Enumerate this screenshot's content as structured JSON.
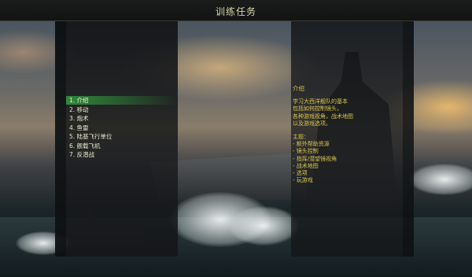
{
  "window": {
    "title": "训练任务"
  },
  "menu": {
    "items": [
      {
        "label": "1. 介绍",
        "selected": true
      },
      {
        "label": "2. 移动",
        "selected": false
      },
      {
        "label": "3. 炮术",
        "selected": false
      },
      {
        "label": "4. 鱼雷",
        "selected": false
      },
      {
        "label": "5. 陆基飞行单位",
        "selected": false
      },
      {
        "label": "6. 舰载飞机",
        "selected": false
      },
      {
        "label": "7. 反潜战",
        "selected": false
      }
    ]
  },
  "description": {
    "heading": "介绍",
    "paragraph_lines": [
      "学习大西洋舰队的基本",
      "包括如何控制镜头，",
      "各种游戏视角，战术地图",
      "以及游戏选项。"
    ],
    "topics_heading": "主题：",
    "topics": [
      "- 额外帮助资源",
      "- 镜头控制",
      "- 指挥/潜望镜视角",
      "- 战术地图",
      "- 选项",
      "- 玩游戏"
    ]
  },
  "colors": {
    "accent_text": "#d9c24a",
    "menu_text": "#e8e6c8",
    "selection": "#2f8a3a",
    "title": "#d8d6a6"
  }
}
